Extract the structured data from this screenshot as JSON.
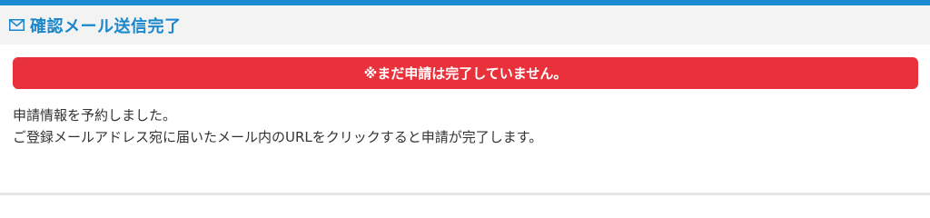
{
  "header": {
    "icon": "mail-icon",
    "title": "確認メール送信完了"
  },
  "alert": {
    "text": "※まだ申請は完了していません。"
  },
  "message": {
    "line1": "申請情報を予約しました。",
    "line2": "ご登録メールアドレス宛に届いたメール内のURLをクリックすると申請が完了します。"
  },
  "colors": {
    "accent": "#1a86cc",
    "alert": "#e8313b",
    "header_bg": "#f3f3f3"
  }
}
